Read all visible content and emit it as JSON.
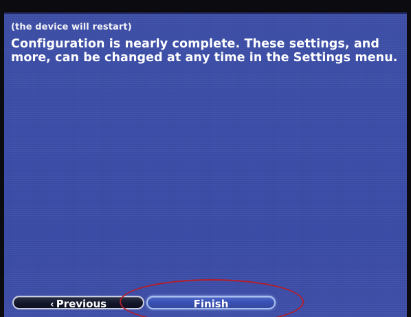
{
  "dialog": {
    "restart_note": "(the device will restart)",
    "message": "Configuration is nearly complete. These settings, and more, can be changed at any time in the Settings menu."
  },
  "buttons": {
    "previous_label": "Previous",
    "previous_icon": "chevron-left-icon",
    "finish_label": "Finish"
  },
  "colors": {
    "screen_background": "#3c4da7",
    "highlight_ring": "#b31e2a",
    "text": "#ffffff"
  }
}
